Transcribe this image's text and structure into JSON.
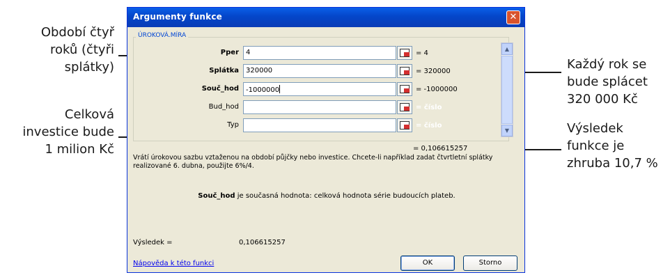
{
  "callouts": {
    "periods": [
      "Období čtyř",
      "roků (čtyři",
      "splátky)"
    ],
    "investment": [
      "Celková",
      "investice bude",
      "1 milion Kč"
    ],
    "payment": [
      "Každý rok se",
      "bude splácet",
      "320 000 Kč"
    ],
    "result": [
      "Výsledek",
      "funkce je",
      "zhruba 10,7 %"
    ]
  },
  "dialog": {
    "title": "Argumenty funkce",
    "close_glyph": "✕",
    "function_name": "ÚROKOVÁ.MÍRA",
    "arguments": [
      {
        "name": "Pper",
        "bold": true,
        "value": "4",
        "result": "= 4"
      },
      {
        "name": "Splátka",
        "bold": true,
        "value": "320000",
        "result": "= 320000"
      },
      {
        "name": "Souč_hod",
        "bold": true,
        "value": "-1000000",
        "result": "= -1000000"
      },
      {
        "name": "Bud_hod",
        "bold": false,
        "value": "",
        "result": "= číslo"
      },
      {
        "name": "Typ",
        "bold": false,
        "value": "",
        "result": "= číslo"
      }
    ],
    "scroll_up": "▲",
    "scroll_down": "▼",
    "total_result": "= 0,106615257",
    "description": "Vrátí úrokovou sazbu vztaženou na období půjčky nebo investice. Chcete-li například zadat čtvrtletní splátky realizované 6. dubna, použijte 6%/4.",
    "arg_help_name": "Souč_hod",
    "arg_help_text": " je současná hodnota: celková hodnota série budoucích plateb.",
    "result_label": "Výsledek =",
    "result_value": "0,106615257",
    "help_link": "Nápověda k této funkci",
    "ok_label": "OK",
    "cancel_label": "Storno"
  }
}
